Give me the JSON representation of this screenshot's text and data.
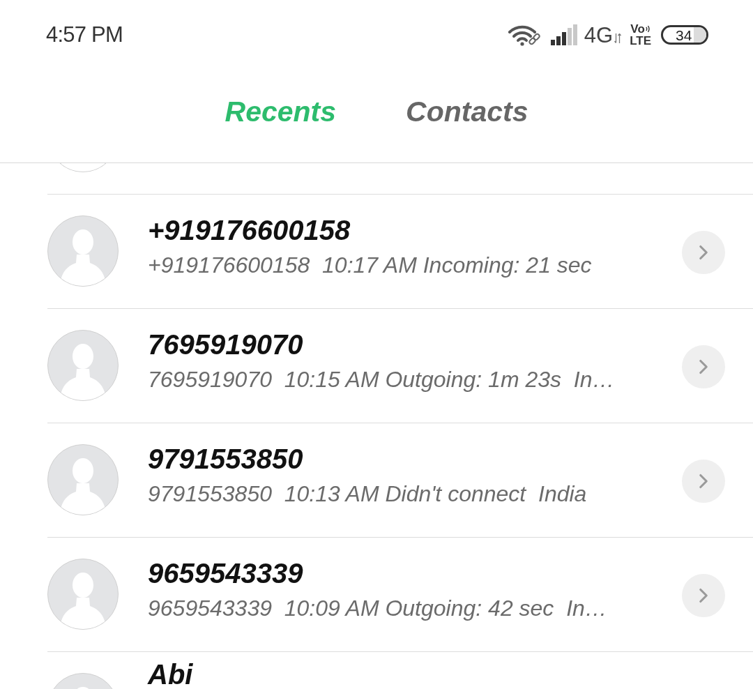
{
  "status_bar": {
    "time": "4:57 PM",
    "network": "4G",
    "volte_top": "Vo",
    "volte_bottom": "LTE",
    "battery": "34"
  },
  "tabs": [
    {
      "label": "Recents",
      "selected": true
    },
    {
      "label": "Contacts",
      "selected": false
    }
  ],
  "call_list": {
    "row_above_cut": true,
    "calls": [
      {
        "name": "+919176600158",
        "detail": "+919176600158  10:17 AM Incoming: 21 sec"
      },
      {
        "name": "7695919070",
        "detail": "7695919070  10:15 AM Outgoing: 1m 23s  In…"
      },
      {
        "name": "9791553850",
        "detail": "9791553850  10:13 AM Didn't connect  India"
      },
      {
        "name": "9659543339",
        "detail": "9659543339  10:09 AM Outgoing: 42 sec  In…"
      },
      {
        "name": "Abi"
      }
    ]
  }
}
